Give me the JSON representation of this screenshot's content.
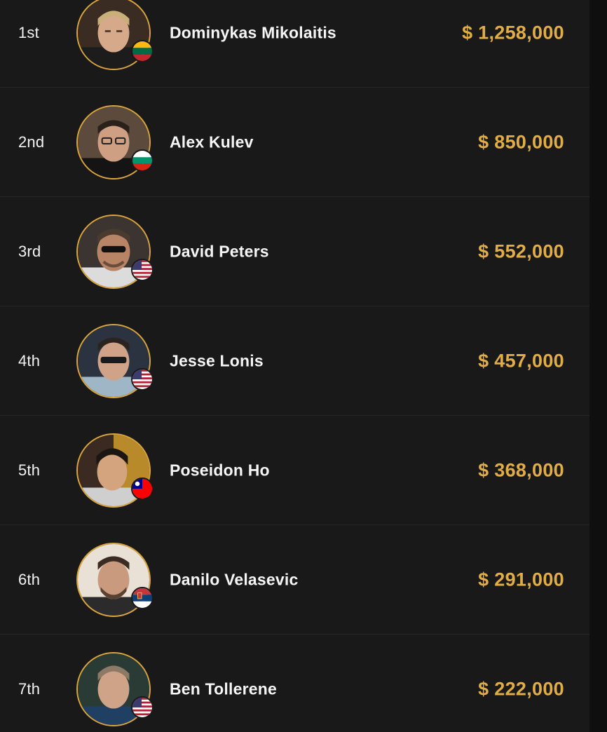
{
  "colors": {
    "background": "#191919",
    "divider": "#262626",
    "accent_gold": "#e2ad43",
    "text": "#f5f5f5"
  },
  "players": [
    {
      "place": "1st",
      "name": "Dominykas Mikolaitis",
      "prize": "$ 1,258,000",
      "flag_icon": "lithuania-flag-icon"
    },
    {
      "place": "2nd",
      "name": "Alex Kulev",
      "prize": "$ 850,000",
      "flag_icon": "bulgaria-flag-icon"
    },
    {
      "place": "3rd",
      "name": "David Peters",
      "prize": "$ 552,000",
      "flag_icon": "usa-flag-icon"
    },
    {
      "place": "4th",
      "name": "Jesse Lonis",
      "prize": "$ 457,000",
      "flag_icon": "usa-flag-icon"
    },
    {
      "place": "5th",
      "name": "Poseidon Ho",
      "prize": "$ 368,000",
      "flag_icon": "taiwan-flag-icon"
    },
    {
      "place": "6th",
      "name": "Danilo Velasevic",
      "prize": "$ 291,000",
      "flag_icon": "serbia-flag-icon"
    },
    {
      "place": "7th",
      "name": "Ben Tollerene",
      "prize": "$ 222,000",
      "flag_icon": "usa-flag-icon"
    }
  ]
}
